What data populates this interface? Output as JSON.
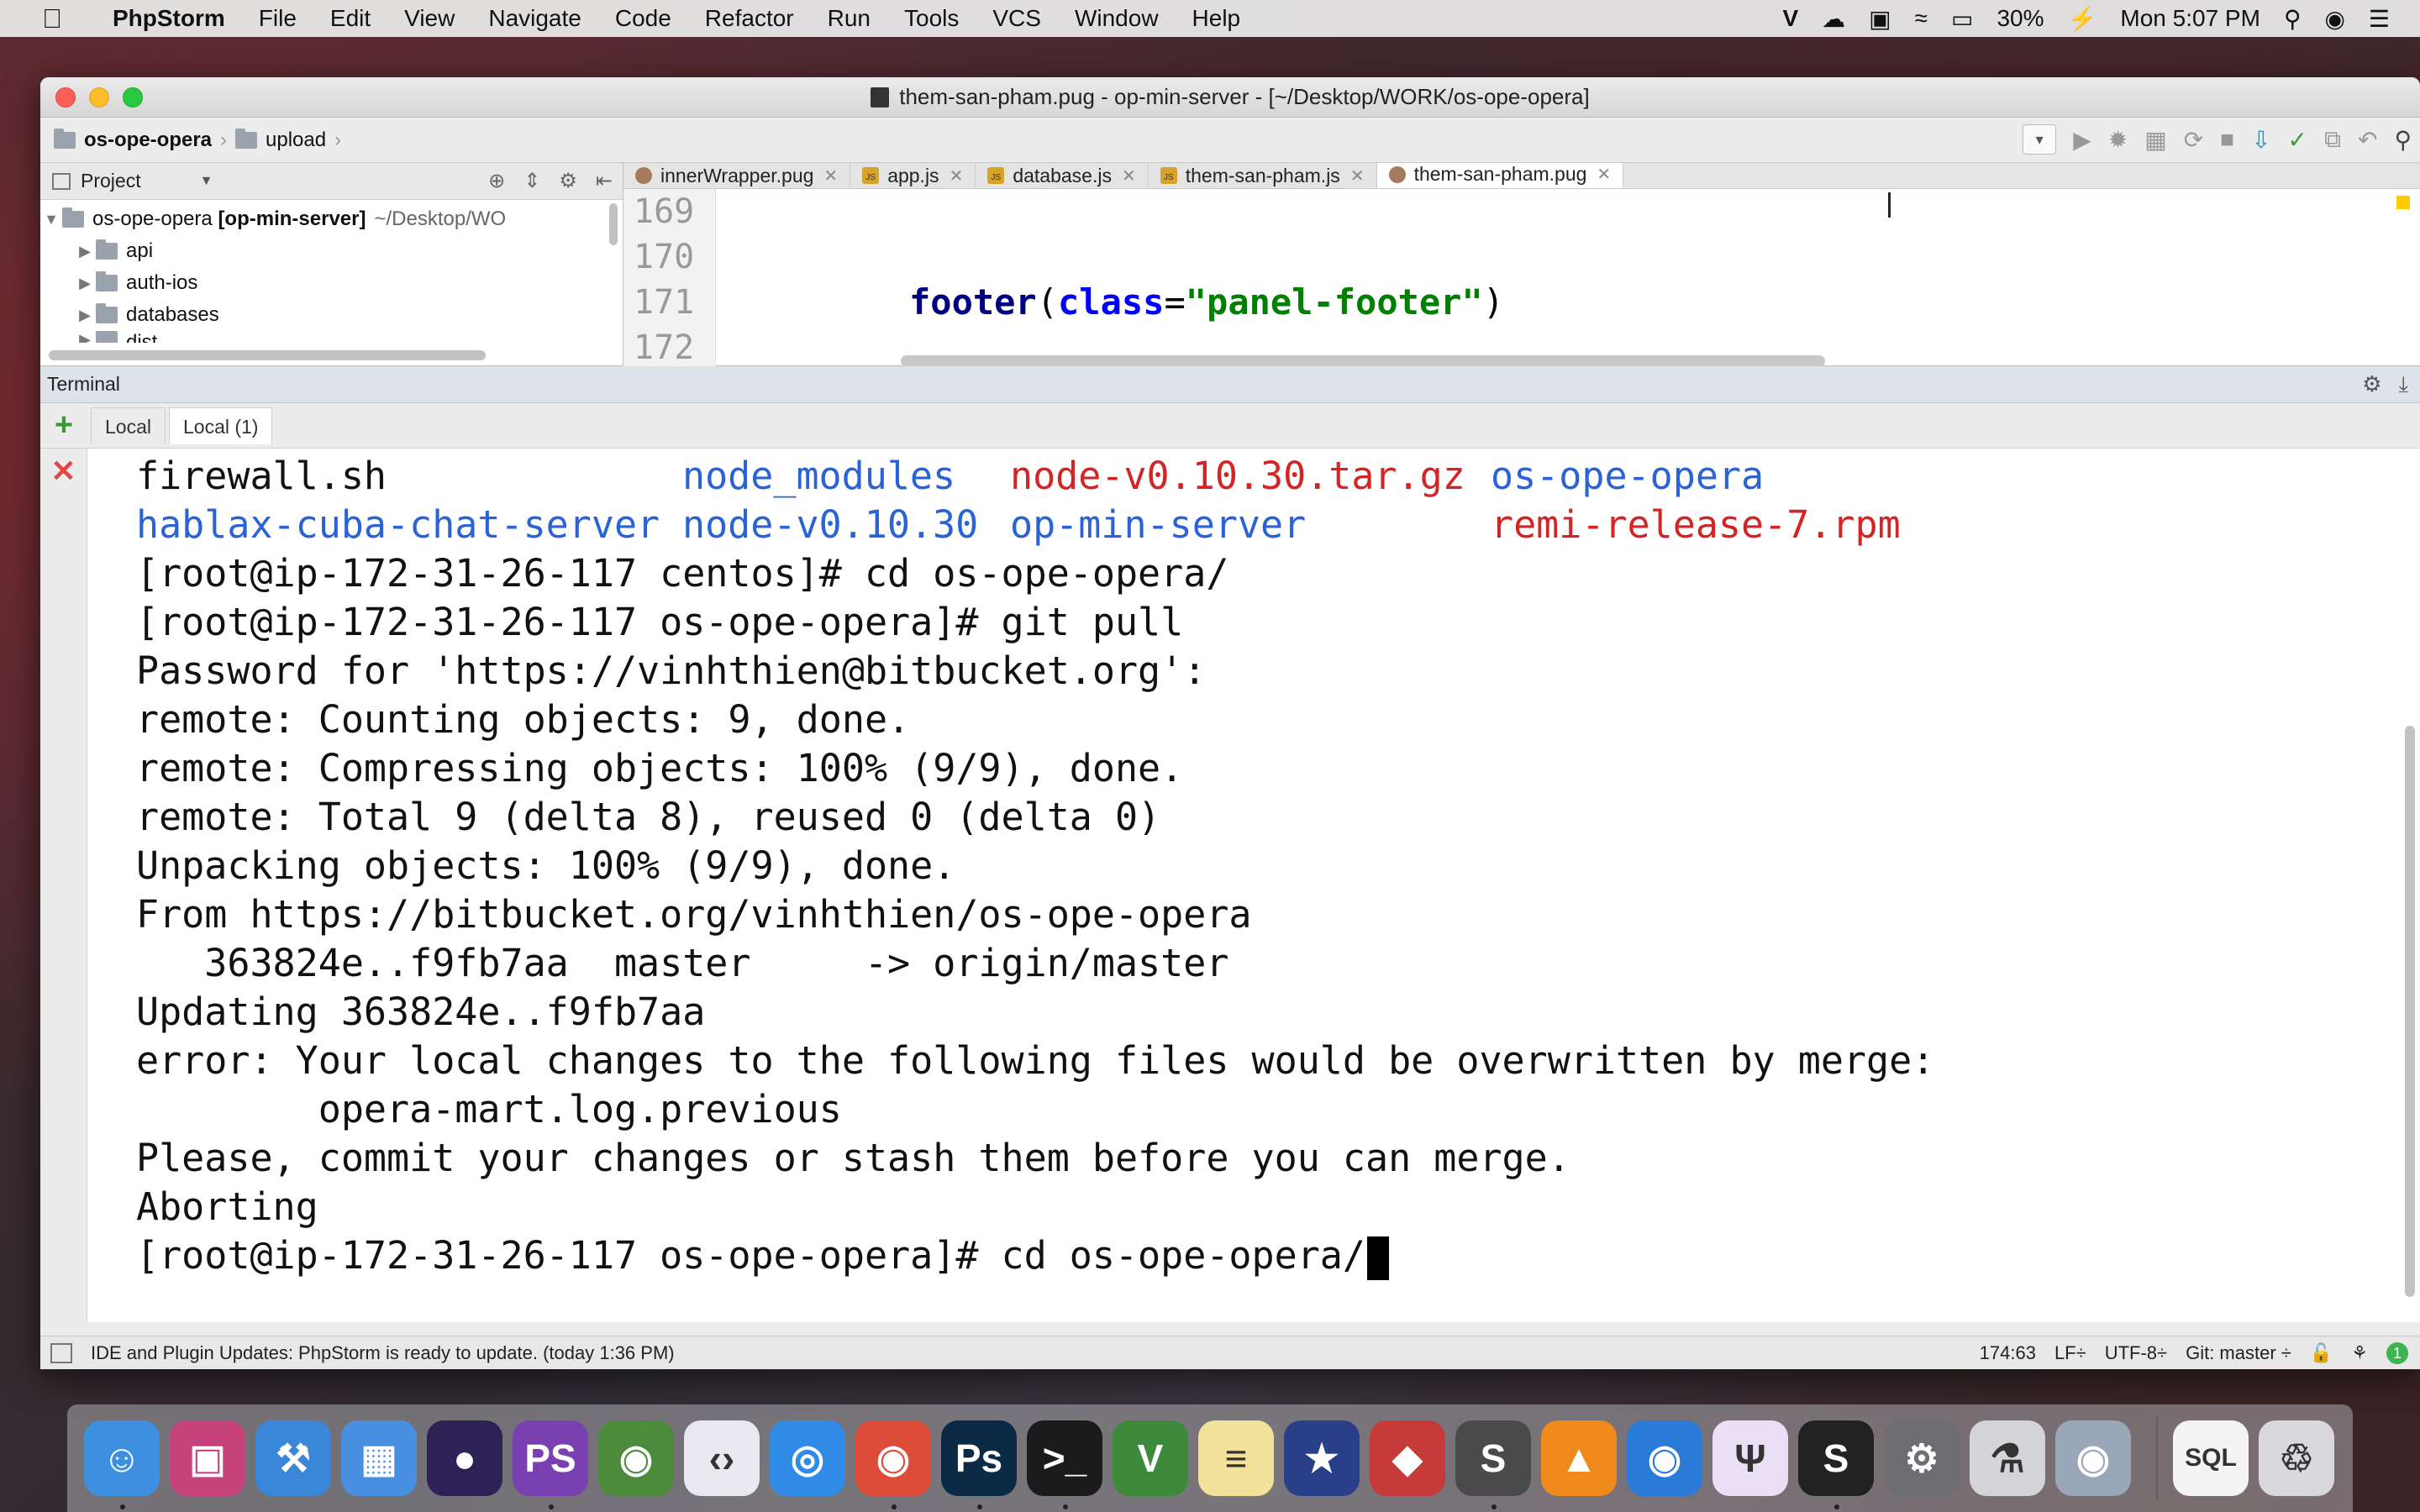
{
  "menubar": {
    "app_name": "PhpStorm",
    "items": [
      "File",
      "Edit",
      "View",
      "Navigate",
      "Code",
      "Refactor",
      "Run",
      "Tools",
      "VCS",
      "Window",
      "Help"
    ],
    "battery": "30%",
    "clock": "Mon 5:07 PM"
  },
  "window": {
    "title": "them-san-pham.pug - op-min-server - [~/Desktop/WORK/os-ope-opera]"
  },
  "navbar": {
    "crumb1": "os-ope-opera",
    "crumb2": "upload"
  },
  "project": {
    "header": "Project",
    "root_name": "os-ope-opera",
    "root_module": "[op-min-server]",
    "root_path": "~/Desktop/WO",
    "items": [
      "api",
      "auth-ios",
      "databases",
      "dist"
    ]
  },
  "tabs": [
    {
      "label": "innerWrapper.pug",
      "type": "pug"
    },
    {
      "label": "app.js",
      "type": "js"
    },
    {
      "label": "database.js",
      "type": "js"
    },
    {
      "label": "them-san-pham.js",
      "type": "js"
    },
    {
      "label": "them-san-pham.pug",
      "type": "pug"
    }
  ],
  "editor": {
    "line_numbers": [
      "169",
      "170",
      "171",
      "172"
    ],
    "code_kw": "footer",
    "code_attr": "class",
    "code_str": "\"panel-footer\""
  },
  "terminal": {
    "title": "Terminal",
    "tabs": [
      "Local",
      "Local (1)"
    ],
    "ls_row1": [
      "firewall.sh",
      "node_modules",
      "node-v0.10.30.tar.gz",
      "os-ope-opera"
    ],
    "ls_row2": [
      "hablax-cuba-chat-server",
      "node-v0.10.30",
      "op-min-server",
      "remi-release-7.rpm"
    ],
    "lines": [
      "[root@ip-172-31-26-117 centos]# cd os-ope-opera/",
      "[root@ip-172-31-26-117 os-ope-opera]# git pull",
      "Password for 'https://vinhthien@bitbucket.org':",
      "remote: Counting objects: 9, done.",
      "remote: Compressing objects: 100% (9/9), done.",
      "remote: Total 9 (delta 8), reused 0 (delta 0)",
      "Unpacking objects: 100% (9/9), done.",
      "From https://bitbucket.org/vinhthien/os-ope-opera",
      "   363824e..f9fb7aa  master     -> origin/master",
      "Updating 363824e..f9fb7aa",
      "error: Your local changes to the following files would be overwritten by merge:",
      "        opera-mart.log.previous",
      "Please, commit your changes or stash them before you can merge.",
      "Aborting"
    ],
    "prompt_line": "[root@ip-172-31-26-117 os-ope-opera]# cd os-ope-opera/"
  },
  "statusbar": {
    "message": "IDE and Plugin Updates: PhpStorm is ready to update. (today 1:36 PM)",
    "position": "174:63",
    "line_sep": "LF÷",
    "encoding": "UTF-8÷",
    "git": "Git: master ÷",
    "badge": "1"
  },
  "dock": [
    {
      "name": "finder-icon",
      "color": "#3d8fe0",
      "glyph": "☺"
    },
    {
      "name": "system-monitor-icon",
      "color": "#c7417b",
      "glyph": "▣"
    },
    {
      "name": "xcode-icon",
      "color": "#3a86d8",
      "glyph": "⚒"
    },
    {
      "name": "simulator-icon",
      "color": "#4a90e2",
      "glyph": "▦"
    },
    {
      "name": "eclipse-icon",
      "color": "#2c2255",
      "glyph": "●"
    },
    {
      "name": "phpstorm-icon",
      "color": "#7a3fb0",
      "glyph": "PS"
    },
    {
      "name": "android-studio-icon",
      "color": "#4c8a3c",
      "glyph": "◉"
    },
    {
      "name": "code-editor-icon",
      "color": "#e8e8ee",
      "glyph": "‹›"
    },
    {
      "name": "safari-icon",
      "color": "#2f8be6",
      "glyph": "◎"
    },
    {
      "name": "chrome-icon",
      "color": "#dd4b39",
      "glyph": "◉"
    },
    {
      "name": "photoshop-icon",
      "color": "#0b2a46",
      "glyph": "Ps"
    },
    {
      "name": "terminal-icon",
      "color": "#1b1b1b",
      "glyph": ">_"
    },
    {
      "name": "vim-icon",
      "color": "#3d8a3a",
      "glyph": "V"
    },
    {
      "name": "notes-icon",
      "color": "#f3e39a",
      "glyph": "≡"
    },
    {
      "name": "star-app-icon",
      "color": "#2a3f8a",
      "glyph": "★"
    },
    {
      "name": "git-client-icon",
      "color": "#c63a3a",
      "glyph": "◆"
    },
    {
      "name": "sublime-text-icon",
      "color": "#4a4a4a",
      "glyph": "S"
    },
    {
      "name": "vlc-icon",
      "color": "#f08a1c",
      "glyph": "▲"
    },
    {
      "name": "pp-assistant-icon",
      "color": "#2a7ad8",
      "glyph": "◉"
    },
    {
      "name": "usb-tool-icon",
      "color": "#e9e0f5",
      "glyph": "Ψ"
    },
    {
      "name": "scrivener-icon",
      "color": "#222222",
      "glyph": "S"
    },
    {
      "name": "system-preferences-icon",
      "color": "#6d6d72",
      "glyph": "⚙"
    },
    {
      "name": "database-tool-icon",
      "color": "#d4d4d8",
      "glyph": "⚗"
    },
    {
      "name": "sequel-pro-icon",
      "color": "#9aa7b8",
      "glyph": "◉"
    },
    {
      "name": "sql-file-icon",
      "color": "#f4f4f4",
      "glyph": "SQL"
    },
    {
      "name": "trash-icon",
      "color": "#d9d9dd",
      "glyph": "♲"
    }
  ]
}
